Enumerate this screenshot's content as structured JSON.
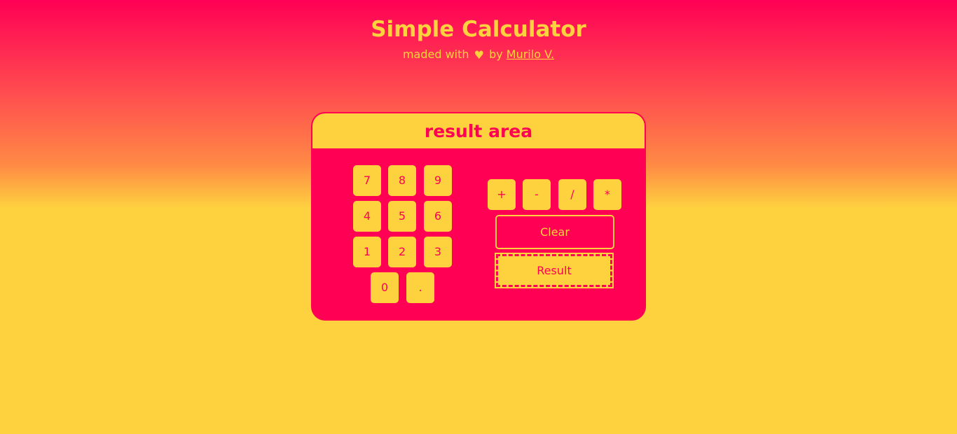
{
  "header": {
    "title": "Simple Calculator",
    "subtitle_prefix": "maded with",
    "heart_icon": "heart-icon",
    "subtitle_by": "by",
    "author": "Murilo V."
  },
  "calculator": {
    "result_placeholder": "result area",
    "digits": [
      "7",
      "8",
      "9",
      "4",
      "5",
      "6",
      "1",
      "2",
      "3",
      "0",
      "."
    ],
    "operators": [
      "+",
      "-",
      "/",
      "*"
    ],
    "clear_label": "Clear",
    "result_label": "Result"
  },
  "colors": {
    "primary": "#ff0055",
    "accent": "#fed23f"
  }
}
